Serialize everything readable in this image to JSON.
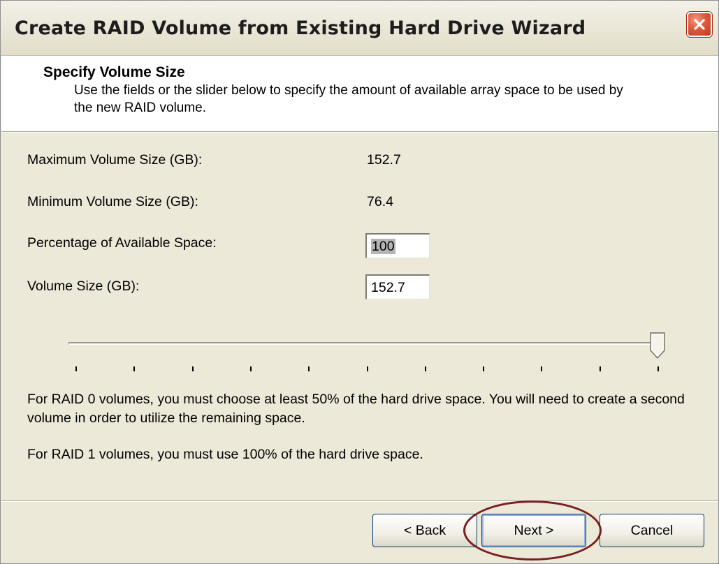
{
  "window": {
    "title": "Create RAID Volume from Existing Hard Drive Wizard"
  },
  "header": {
    "title": "Specify Volume Size",
    "description": "Use the fields or the slider below to specify the amount of available array space to be used by the new RAID volume."
  },
  "fields": {
    "max_label": "Maximum Volume Size (GB):",
    "max_value": "152.7",
    "min_label": "Minimum Volume Size (GB):",
    "min_value": "76.4",
    "percent_label": "Percentage of Available Space:",
    "percent_value": "100",
    "size_label": "Volume Size (GB):",
    "size_value": "152.7"
  },
  "slider": {
    "value_percent": 100,
    "tick_count": 11
  },
  "notes": {
    "raid0": "For RAID 0 volumes, you must choose at least 50% of the hard drive space. You will need to create a second volume in order to utilize the remaining space.",
    "raid1": "For RAID 1 volumes, you must use 100% of the hard drive space."
  },
  "buttons": {
    "back": "< Back",
    "next": "Next >",
    "cancel": "Cancel"
  },
  "icons": {
    "close": "close-icon"
  },
  "colors": {
    "close_button": "#dd5a3c",
    "annotation_circle": "#7a1f1f",
    "default_button_focus": "#99b4e0"
  }
}
